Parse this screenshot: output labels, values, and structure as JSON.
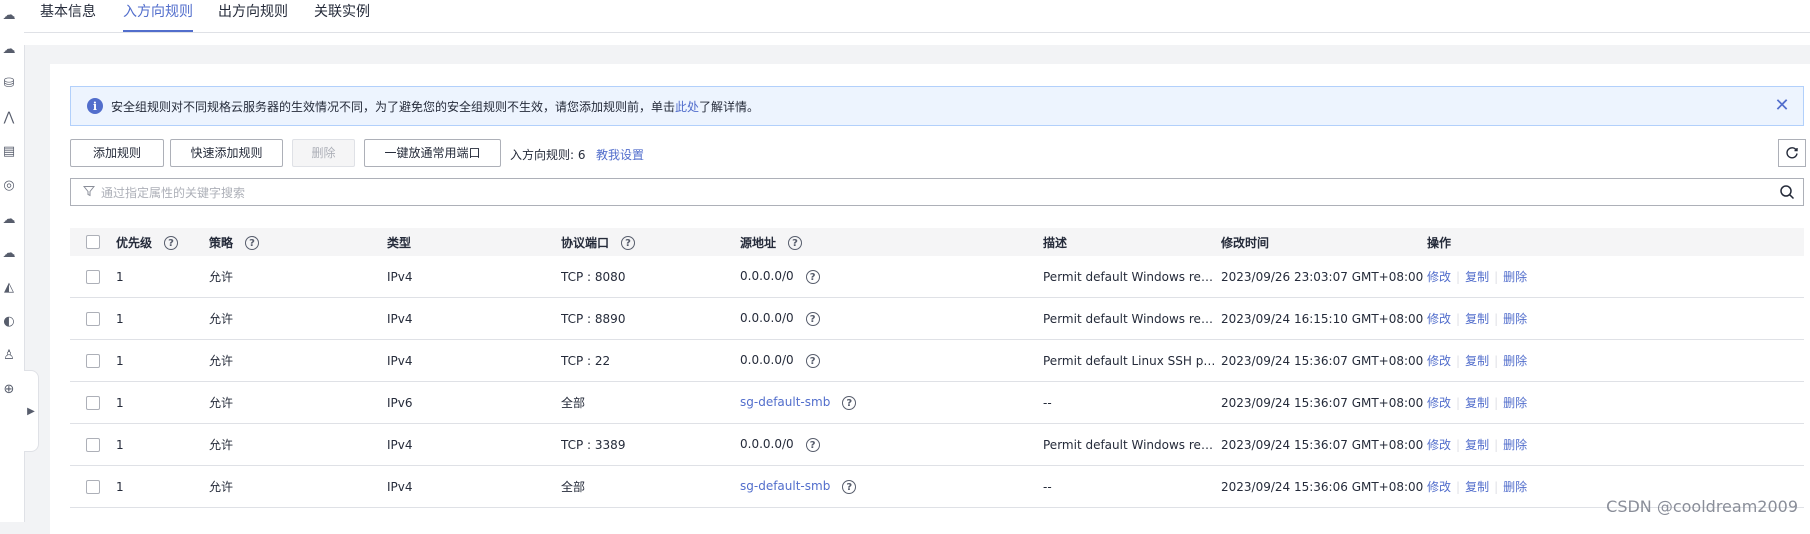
{
  "tabs": [
    {
      "label": "基本信息",
      "active": false
    },
    {
      "label": "入方向规则",
      "active": true
    },
    {
      "label": "出方向规则",
      "active": false
    },
    {
      "label": "关联实例",
      "active": false
    }
  ],
  "alert": {
    "text_before": "安全组规则对不同规格云服务器的生效情况不同，为了避免您的安全组规则不生效，请您添加规则前，单击",
    "link": "此处",
    "text_after": "了解详情。"
  },
  "toolbar": {
    "add_rule": "添加规则",
    "quick_add_rule": "快速添加规则",
    "delete": "删除",
    "open_common_ports": "一键放通常用端口",
    "rule_count": "入方向规则: 6",
    "teach_me": "教我设置"
  },
  "search": {
    "placeholder": "通过指定属性的关键字搜索"
  },
  "table": {
    "headers": {
      "priority": "优先级",
      "policy": "策略",
      "type": "类型",
      "protocol_port": "协议端口",
      "source": "源地址",
      "description": "描述",
      "modified": "修改时间",
      "actions": "操作"
    },
    "rows": [
      {
        "priority": "1",
        "policy": "允许",
        "type": "IPv4",
        "protocol_port": "TCP : 8080",
        "source": "0.0.0.0/0",
        "description": "Permit default Windows remote ...",
        "modified": "2023/09/26 23:03:07 GMT+08:00"
      },
      {
        "priority": "1",
        "policy": "允许",
        "type": "IPv4",
        "protocol_port": "TCP : 8890",
        "source": "0.0.0.0/0",
        "description": "Permit default Windows remote ...",
        "modified": "2023/09/24 16:15:10 GMT+08:00"
      },
      {
        "priority": "1",
        "policy": "允许",
        "type": "IPv4",
        "protocol_port": "TCP : 22",
        "source": "0.0.0.0/0",
        "description": "Permit default Linux SSH port.",
        "modified": "2023/09/24 15:36:07 GMT+08:00"
      },
      {
        "priority": "1",
        "policy": "允许",
        "type": "IPv6",
        "protocol_port": "全部",
        "source": "sg-default-smb",
        "description": "--",
        "modified": "2023/09/24 15:36:07 GMT+08:00"
      },
      {
        "priority": "1",
        "policy": "允许",
        "type": "IPv4",
        "protocol_port": "TCP : 3389",
        "source": "0.0.0.0/0",
        "description": "Permit default Windows remote ...",
        "modified": "2023/09/24 15:36:07 GMT+08:00"
      },
      {
        "priority": "1",
        "policy": "允许",
        "type": "IPv4",
        "protocol_port": "全部",
        "source": "sg-default-smb",
        "description": "--",
        "modified": "2023/09/24 15:36:06 GMT+08:00"
      }
    ],
    "row_actions": {
      "modify": "修改",
      "copy": "复制",
      "delete": "删除"
    }
  },
  "watermark": "CSDN @cooldream2009",
  "colors": {
    "accent": "#526ecc",
    "border": "#dfe1e6",
    "header_bg": "#f5f5f6",
    "alert_bg": "#edf4fe"
  }
}
